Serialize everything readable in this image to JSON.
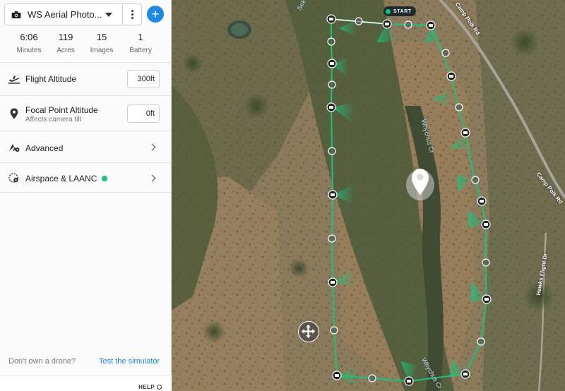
{
  "plan": {
    "title": "WS Aerial Photo..."
  },
  "stats": [
    {
      "value": "6:06",
      "label": "Minutes"
    },
    {
      "value": "119",
      "label": "Acres"
    },
    {
      "value": "15",
      "label": "Images"
    },
    {
      "value": "1",
      "label": "Battery"
    }
  ],
  "settings": {
    "flight_altitude": {
      "label": "Flight Altitude",
      "value": "300ft"
    },
    "focal_point_altitude": {
      "label": "Focal Point Altitude",
      "sublabel": "Affects camera tilt",
      "value": "0ft"
    },
    "advanced": {
      "label": "Advanced"
    },
    "airspace": {
      "label": "Airspace & LAANC"
    }
  },
  "footer": {
    "no_drone_text": "Don't own a drone?",
    "simulator_link": "Test the simulator",
    "help_label": "HELP"
  },
  "map": {
    "start_label": "START",
    "road_labels": [
      "Camp Polk Rd",
      "Camp Polk Rd",
      "Hawks Flight Dr"
    ],
    "water_labels": [
      "Whychus Cr",
      "Whychus Cr",
      "Sek"
    ]
  },
  "colors": {
    "accent": "#1e88e5",
    "path": "#19c37d",
    "status_ok": "#19c37d"
  }
}
